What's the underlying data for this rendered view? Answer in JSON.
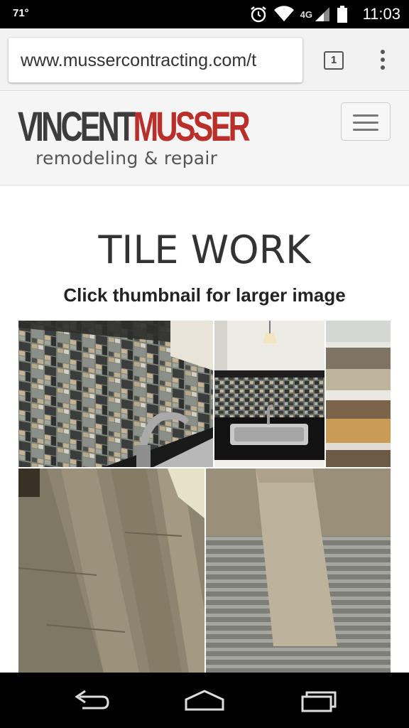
{
  "status_bar": {
    "temperature": "71°",
    "network": "4G",
    "time": "11:03",
    "icons": [
      "alarm-icon",
      "wifi-icon",
      "signal-icon",
      "battery-icon"
    ]
  },
  "browser": {
    "url": "www.mussercontracting.com/t",
    "tab_count": "1"
  },
  "site_header": {
    "logo_first": "VINCENT",
    "logo_second": "MUSSER",
    "logo_tagline": "remodeling & repair",
    "brand_color": "#b9302a"
  },
  "page": {
    "title": "TILE WORK",
    "subtitle": "Click thumbnail for larger image"
  },
  "gallery": {
    "thumbnails": [
      "kitchen-backsplash-mosaic",
      "sink-backsplash",
      "floor-steps",
      "wood-look-tile-floor",
      "tile-plank-on-mortar"
    ]
  }
}
